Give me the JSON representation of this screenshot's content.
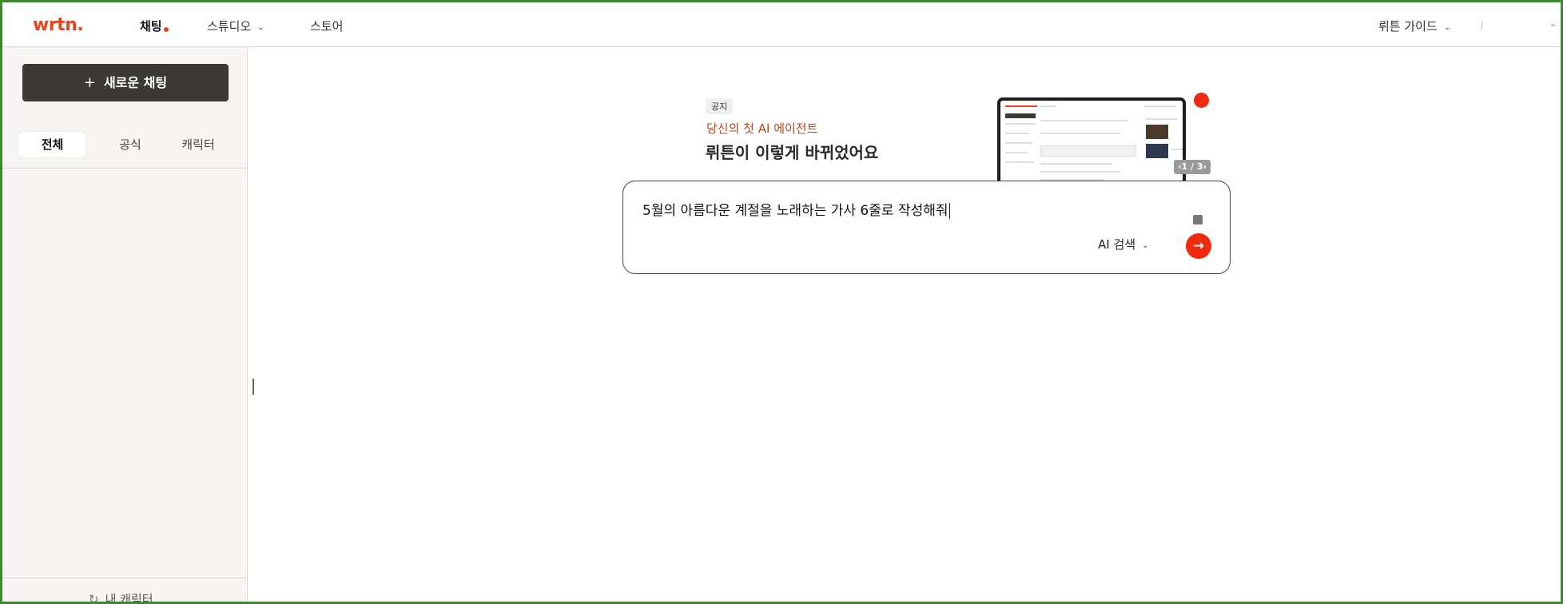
{
  "header": {
    "logo": "wrtn.",
    "nav": [
      {
        "label": "채팅",
        "active": true
      },
      {
        "label": "스튜디오",
        "has_dropdown": true
      },
      {
        "label": "스토어"
      }
    ],
    "guide_label": "뤼튼 가이드"
  },
  "sidebar": {
    "new_chat_label": "새로운 채팅",
    "tabs": [
      "전체",
      "공식",
      "캐릭터"
    ],
    "active_tab": "전체",
    "my_character_label": "내 캐릭터"
  },
  "notice": {
    "tag": "공지",
    "subtitle": "당신의 첫 AI 에이전트",
    "title": "뤼튼이 이렇게 바뀌었어요",
    "pager": "1 / 3"
  },
  "prompt": {
    "value": "5월의 아름다운 계절을 노래하는 가사 6줄로 작성해줘",
    "mode_label": "AI 검색"
  },
  "colors": {
    "brand": "#e8431d",
    "send_button": "#ef2a0f",
    "new_chat_bg": "#3b3936",
    "window_border": "#3d8a2f"
  },
  "icons": {
    "send": "arrow-right-icon",
    "new_chat": "plus-icon",
    "dropdown": "chevron-down-icon",
    "my_character": "refresh-icon"
  }
}
